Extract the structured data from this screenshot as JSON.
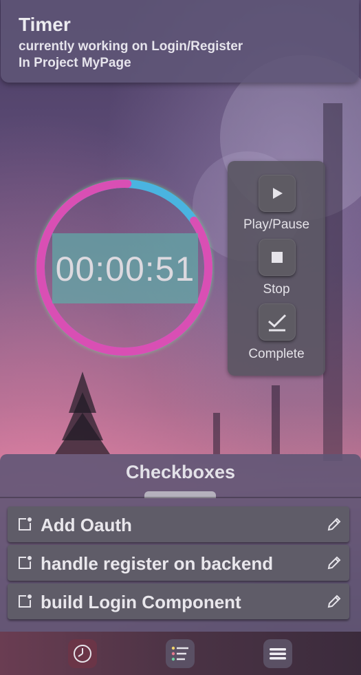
{
  "header": {
    "title": "Timer",
    "subtitle_line1": "currently working on Login/Register",
    "subtitle_line2": "In Project MyPage"
  },
  "timer": {
    "display": "00:00:51",
    "progress_fraction": 0.85,
    "ring_colors": {
      "progress": "#d94fb4",
      "track": "#4ab4e0",
      "glow": "#6fe38a"
    }
  },
  "controls": {
    "play_pause_label": "Play/Pause",
    "stop_label": "Stop",
    "complete_label": "Complete"
  },
  "tasks": {
    "title": "Checkboxes",
    "items": [
      {
        "label": "Add Oauth"
      },
      {
        "label": "handle register on backend"
      },
      {
        "label": "build Login Component"
      }
    ]
  },
  "nav": {
    "items": [
      {
        "icon": "clock-icon",
        "active": true,
        "color": "#6b3547"
      },
      {
        "icon": "list-icon",
        "active": false,
        "color": "#5a5064"
      },
      {
        "icon": "menu-icon",
        "active": false,
        "color": "#5a5064"
      }
    ]
  }
}
